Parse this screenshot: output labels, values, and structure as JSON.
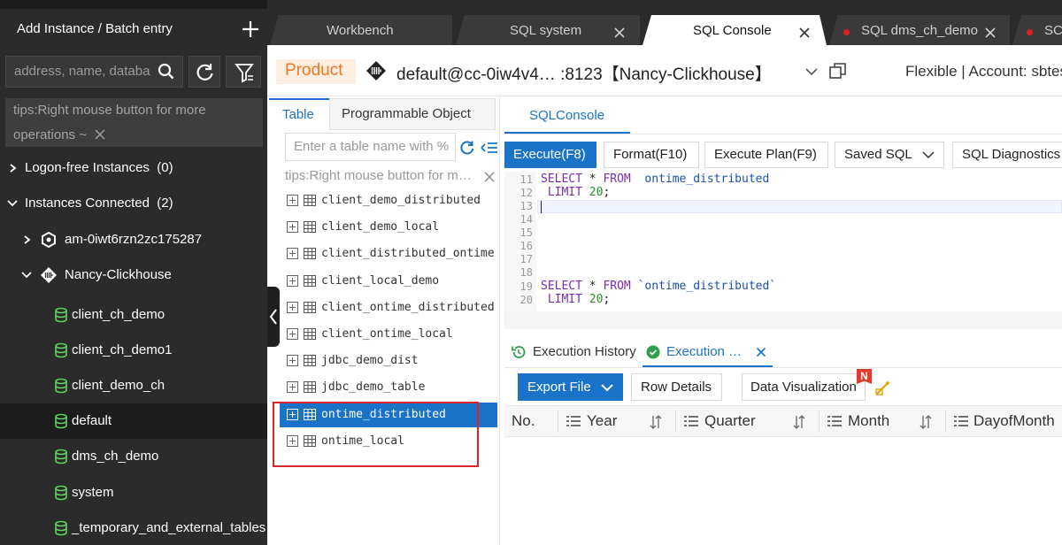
{
  "sidebar": {
    "title": "Add Instance / Batch entry",
    "search_placeholder": "address, name, databa",
    "tip": "tips:Right mouse button for more operations ~",
    "groups": [
      {
        "label": "Logon-free Instances",
        "count": "(0)"
      },
      {
        "label": "Instances Connected",
        "count": "(2)"
      }
    ],
    "instances": [
      {
        "label": "am-0iwt6rzn2zc175287"
      },
      {
        "label": "Nancy-Clickhouse"
      }
    ],
    "databases": [
      {
        "label": "client_ch_demo"
      },
      {
        "label": "client_ch_demo1"
      },
      {
        "label": "client_demo_ch"
      },
      {
        "label": "default"
      },
      {
        "label": "dms_ch_demo"
      },
      {
        "label": "system"
      },
      {
        "label": "_temporary_and_external_tables"
      }
    ],
    "selected_database": "default"
  },
  "tabs": [
    {
      "label": "Workbench"
    },
    {
      "label": "SQL system"
    },
    {
      "label": "SQL Console"
    },
    {
      "label": "SQL dms_ch_demo"
    },
    {
      "label": "SC"
    }
  ],
  "connection": {
    "env_badge": "Product",
    "name": "default@cc-0iw4v4… :8123【Nancy-Clickhouse】",
    "mode": "Flexible | Account: sbtes"
  },
  "object_panel": {
    "tabs": [
      "Table",
      "Programmable Object"
    ],
    "search_placeholder": "Enter a table name with %",
    "tip": "tips:Right mouse button for m…",
    "tables": [
      "client_demo_distributed",
      "client_demo_local",
      "client_distributed_ontime",
      "client_local_demo",
      "client_ontime_distributed",
      "client_ontime_local",
      "jdbc_demo_dist",
      "jdbc_demo_table",
      "ontime_distributed",
      "ontime_local"
    ],
    "selected_table": "ontime_distributed"
  },
  "console": {
    "tab": "SQLConsole",
    "toolbar": {
      "execute": "Execute(F8)",
      "format": "Format(F10)",
      "plan": "Execute Plan(F9)",
      "saved": "Saved SQL",
      "diagnostics": "SQL Diagnostics"
    },
    "editor": {
      "line_numbers": [
        "11",
        "12",
        "13",
        "14",
        "15",
        "16",
        "17",
        "18",
        "19",
        "20"
      ],
      "line11": {
        "kw1": "SELECT",
        "mid": " * ",
        "kw2": "FROM",
        "id": "  ontime_distributed"
      },
      "line12": {
        "kw": " LIMIT",
        "num": " 20",
        "end": ";"
      },
      "line19": {
        "kw1": "SELECT",
        "mid": " * ",
        "kw2": "FROM",
        "id": " `ontime_distributed`"
      },
      "line20": {
        "kw": " LIMIT",
        "num": " 20",
        "end": ";"
      }
    }
  },
  "results": {
    "tabs": {
      "history": "Execution History",
      "exec": "Execution …"
    },
    "buttons": {
      "export": "Export File",
      "row_details": "Row Details",
      "data_viz": "Data Visualization",
      "new_badge": "N"
    },
    "columns": [
      "No.",
      "Year",
      "Quarter",
      "Month",
      "DayofMonth"
    ]
  },
  "colors": {
    "accent": "#1a73c8",
    "sidebar_bg": "#2b2b2b",
    "product_badge": "#f0761f",
    "highlight_box": "#d9262c"
  }
}
